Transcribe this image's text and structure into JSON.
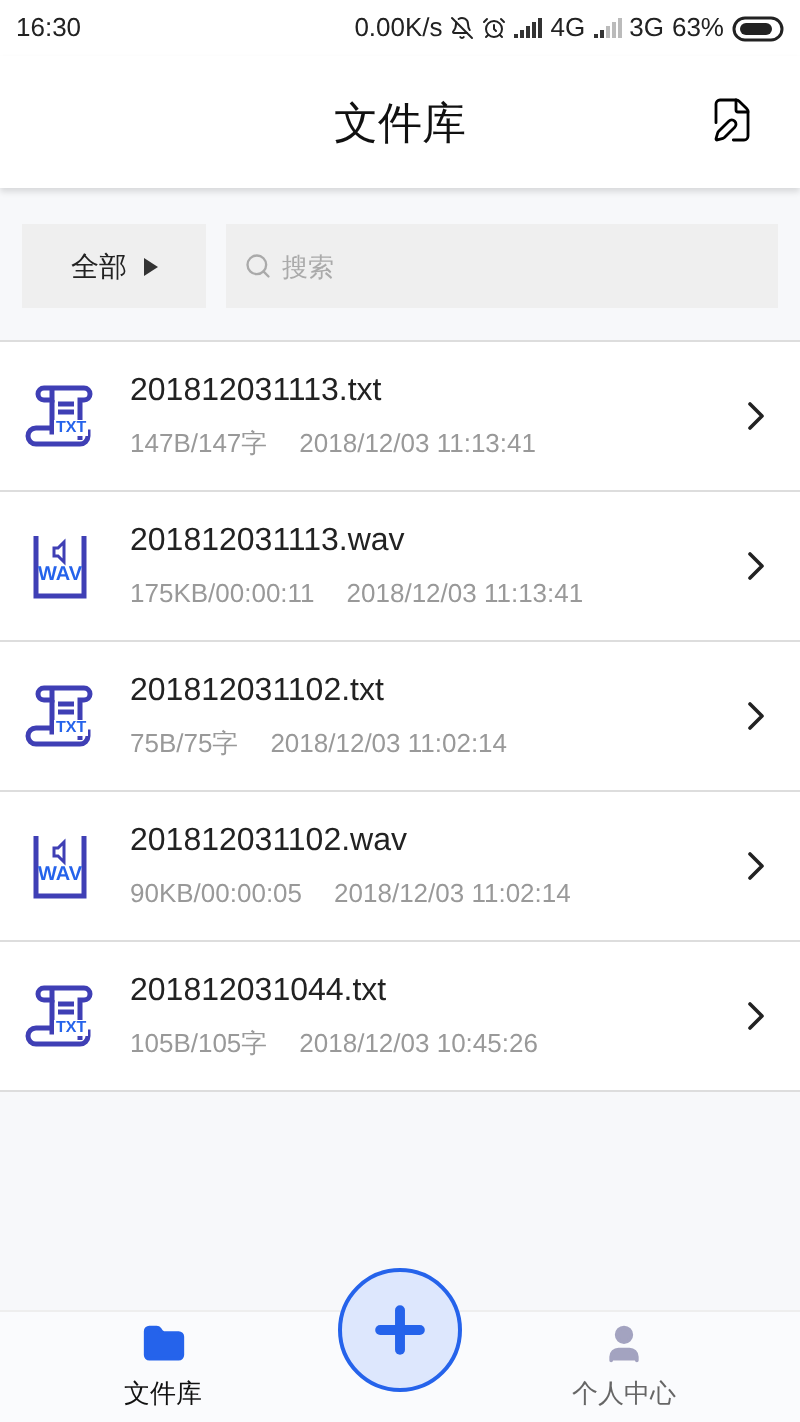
{
  "status_bar": {
    "time": "16:30",
    "speed": "0.00K/s",
    "network_1": "4G",
    "network_2": "3G",
    "battery_percent": "63%"
  },
  "header": {
    "title": "文件库"
  },
  "filter": {
    "dropdown": "全部",
    "search": {
      "placeholder": "搜索"
    }
  },
  "files": [
    {
      "kind": "txt",
      "badge": "TXT",
      "name": "201812031113.txt",
      "size": "147B/147字",
      "date": "2018/12/03 11:13:41"
    },
    {
      "kind": "wav",
      "badge": "WAV",
      "name": "201812031113.wav",
      "size": "175KB/00:00:11",
      "date": "2018/12/03 11:13:41"
    },
    {
      "kind": "txt",
      "badge": "TXT",
      "name": "201812031102.txt",
      "size": "75B/75字",
      "date": "2018/12/03 11:02:14"
    },
    {
      "kind": "wav",
      "badge": "WAV",
      "name": "201812031102.wav",
      "size": "90KB/00:00:05",
      "date": "2018/12/03 11:02:14"
    },
    {
      "kind": "txt",
      "badge": "TXT",
      "name": "201812031044.txt",
      "size": "105B/105字",
      "date": "2018/12/03 10:45:26"
    }
  ],
  "bottom_nav": [
    {
      "kind": "files",
      "label": "文件库",
      "selected": true
    },
    {
      "kind": "profile",
      "label": "个人中心",
      "selected": false
    }
  ]
}
